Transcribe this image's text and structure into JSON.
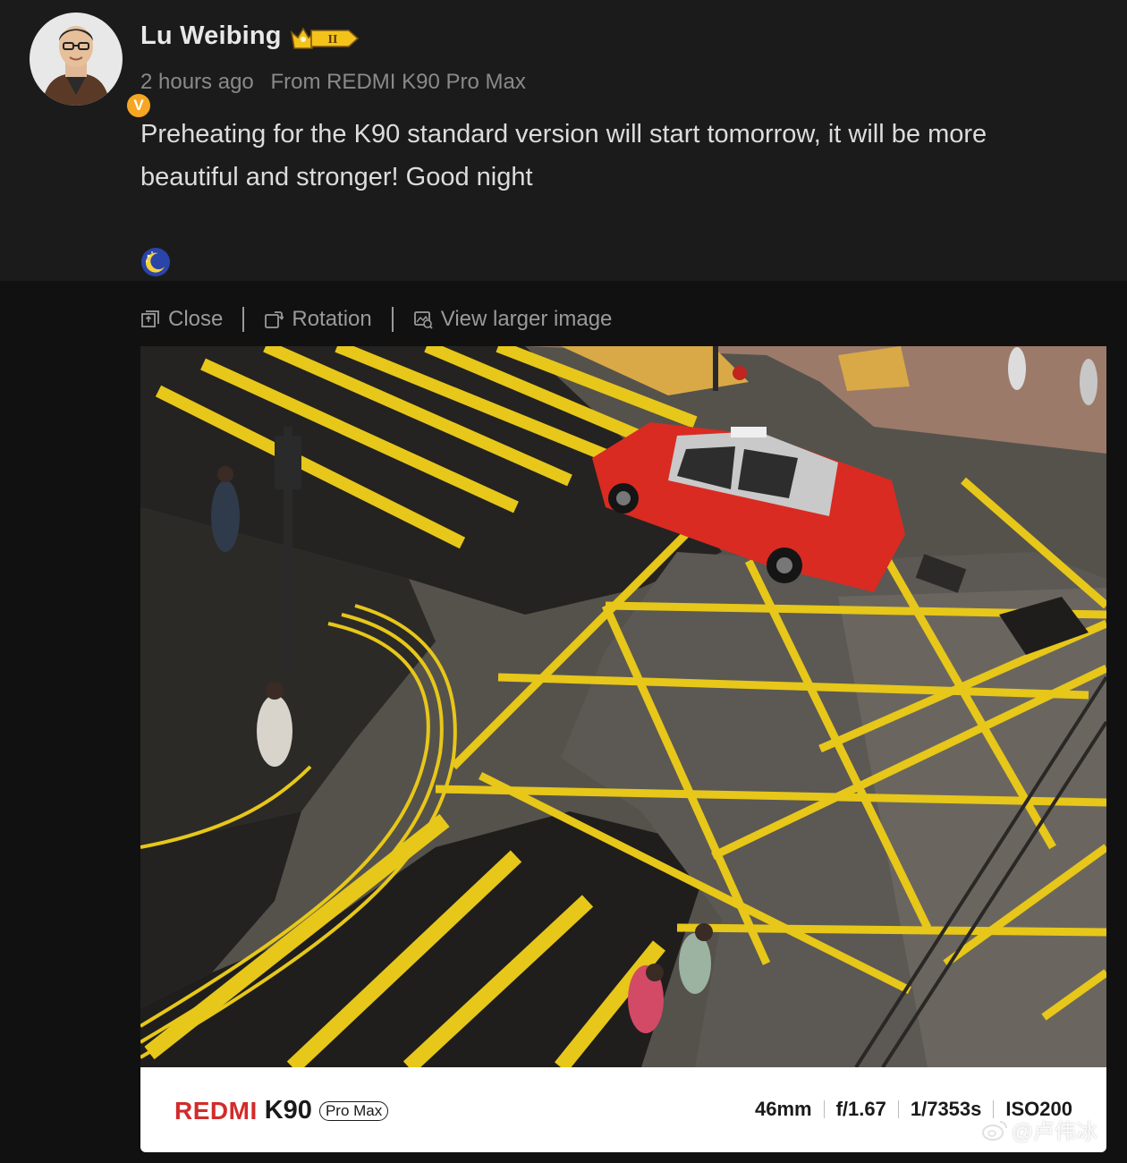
{
  "post": {
    "author": "Lu Weibing",
    "vip_level": "II",
    "time": "2 hours ago",
    "source": "From REDMI K90 Pro Max",
    "text": "Preheating for the K90 standard version will start tomorrow, it will be more beautiful and stronger! Good night",
    "emoji": "moon-emoji"
  },
  "toolbar": {
    "close_label": "Close",
    "rotation_label": "Rotation",
    "view_larger_label": "View larger image"
  },
  "photo_info": {
    "brand": "REDMI",
    "model": "K90",
    "variant": "Pro Max",
    "focal_length": "46mm",
    "aperture": "f/1.67",
    "shutter": "1/7353s",
    "iso": "ISO200"
  },
  "watermark": "@卢伟冰",
  "colors": {
    "background": "#1b1b1b",
    "brand_red": "#d22b2b",
    "road_yellow": "#e7c719",
    "taxi_red": "#d92b22"
  }
}
